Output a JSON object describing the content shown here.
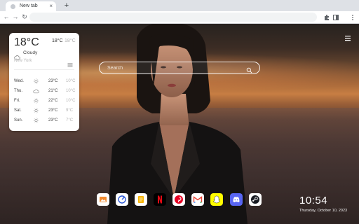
{
  "browser": {
    "tab": {
      "title": "New tab",
      "close_glyph": "×"
    },
    "new_tab_glyph": "+",
    "nav": {
      "back_glyph": "←",
      "forward_glyph": "→",
      "reload_glyph": "↻"
    },
    "omnibox": {
      "value": "",
      "placeholder": ""
    },
    "icons": [
      "extensions-icon",
      "side-panel-icon",
      "kebab-menu-icon"
    ]
  },
  "weather": {
    "current_temp": "18°C",
    "high": "18°C",
    "low": "18°C",
    "condition": "Cloudy",
    "condition_icon": "cloud-icon",
    "city": "New York",
    "forecast": [
      {
        "day": "Wed.",
        "icon": "sun-icon",
        "high": "23°C",
        "low": "10°C"
      },
      {
        "day": "Thu.",
        "icon": "cloud-icon",
        "high": "21°C",
        "low": "10°C"
      },
      {
        "day": "Fri.",
        "icon": "sun-icon",
        "high": "22°C",
        "low": "10°C"
      },
      {
        "day": "Sat.",
        "icon": "sun-icon",
        "high": "23°C",
        "low": "9°C"
      },
      {
        "day": "Sun.",
        "icon": "sun-icon",
        "high": "23°C",
        "low": "7°C"
      }
    ]
  },
  "search": {
    "placeholder": "Search"
  },
  "dock": [
    {
      "name": "photos-app",
      "color": "#ffffff"
    },
    {
      "name": "speedtest-app",
      "color": "#ffffff"
    },
    {
      "name": "notes-app",
      "color": "#ffffff"
    },
    {
      "name": "netflix-app",
      "color": "#000000",
      "accent": "#e50914"
    },
    {
      "name": "pinterest-app",
      "color": "#ffffff",
      "accent": "#e60023"
    },
    {
      "name": "gmail-app",
      "color": "#ffffff",
      "accent": "#ea4335"
    },
    {
      "name": "snapchat-app",
      "color": "#fffc00"
    },
    {
      "name": "discord-app",
      "color": "#5865f2"
    },
    {
      "name": "steam-app",
      "color": "#ffffff",
      "accent": "#171a21"
    }
  ],
  "clock": {
    "time": "10:54",
    "date": "Thursday, October 10, 2023"
  }
}
